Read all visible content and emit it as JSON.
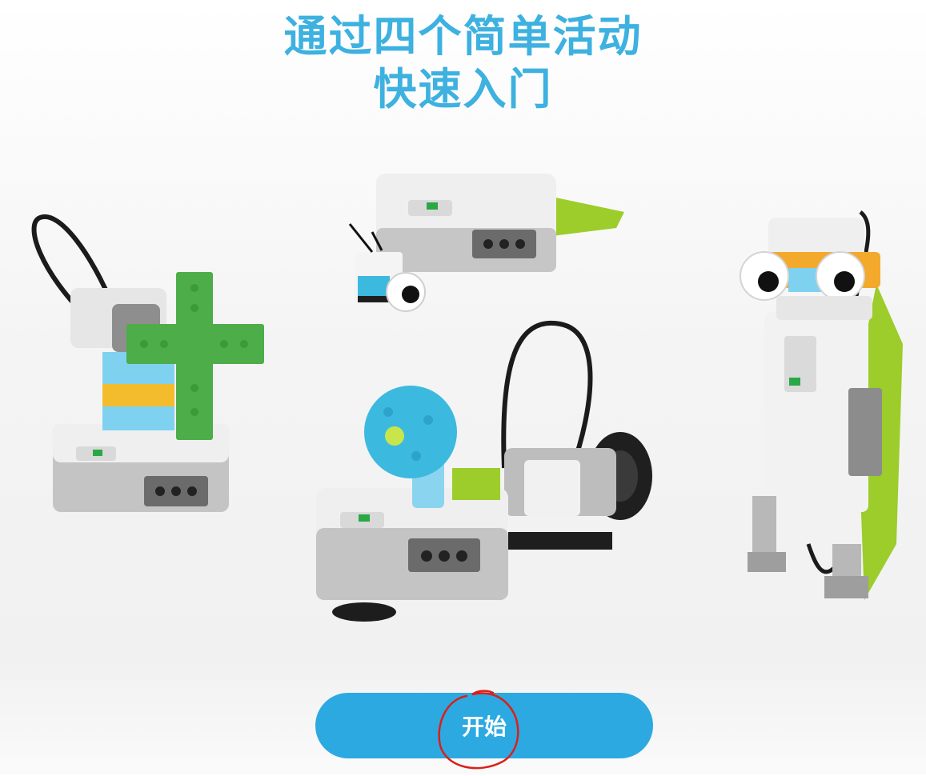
{
  "heading": {
    "line1": "通过四个简单活动",
    "line2": "快速入门"
  },
  "models": [
    {
      "name": "windmill",
      "icon": "windmill-model-image"
    },
    {
      "name": "snail",
      "icon": "snail-model-image"
    },
    {
      "name": "spinner-car",
      "icon": "spinner-car-model-image"
    },
    {
      "name": "frog",
      "icon": "frog-model-image"
    }
  ],
  "start_button": {
    "label": "开始"
  },
  "colors": {
    "title": "#3db1e0",
    "button": "#2ca9e1",
    "annotation": "#d9201b",
    "lego_green": "#4cad49",
    "lego_lime": "#9ccd2a",
    "lego_azure": "#3cb9df",
    "lego_grey": "#b4b4b4"
  }
}
